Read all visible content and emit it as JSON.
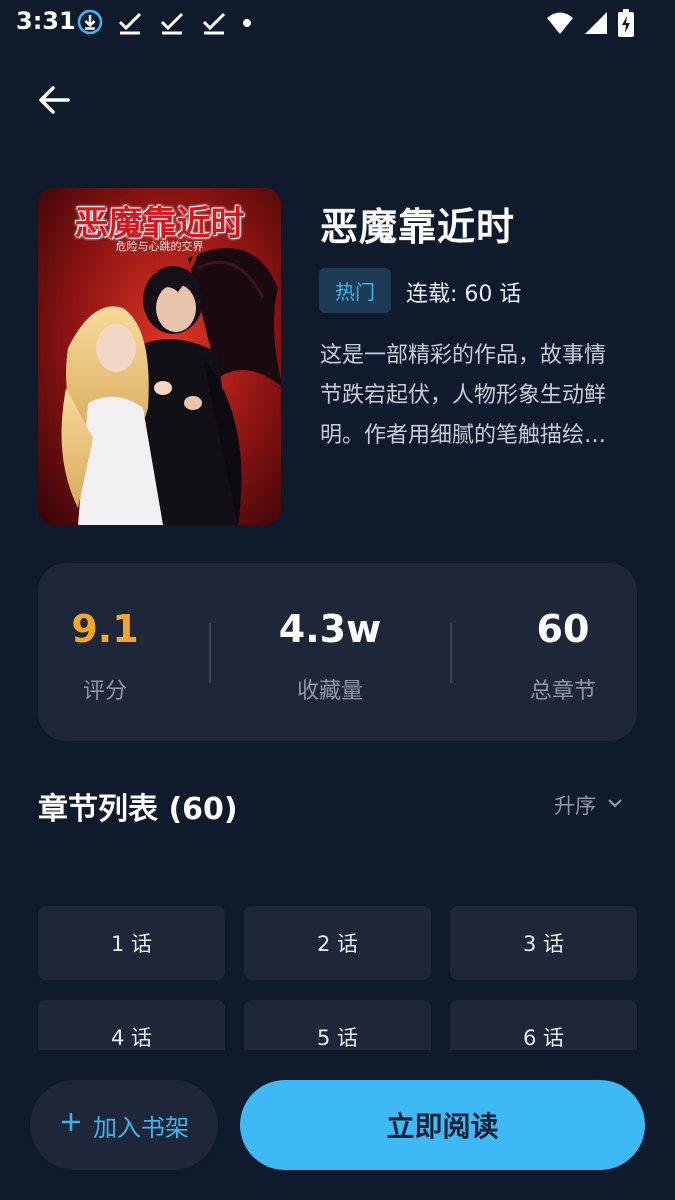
{
  "status_bar": {
    "time": "3:31",
    "icons_left": [
      "download-icon",
      "check-icon",
      "check-icon",
      "check-icon",
      "dot-icon"
    ],
    "icons_right": [
      "wifi-icon",
      "signal-icon",
      "battery-charging-icon"
    ]
  },
  "nav": {
    "back_icon": "arrow-left-icon"
  },
  "book": {
    "cover_title": "恶魔靠近时",
    "cover_subtitle": "危险与心跳的交界",
    "title": "恶魔靠近时",
    "tag": "热门",
    "serial": "连载: 60 话",
    "description": "这是一部精彩的作品，故事情节跌宕起伏，人物形象生动鲜明。作者用细腻的笔触描绘了一个引人入胜的故事。"
  },
  "stats": {
    "rating_value": "9.1",
    "rating_label": "评分",
    "favorites_value": "4.3w",
    "favorites_label": "收藏量",
    "chapters_value": "60",
    "chapters_label": "总章节"
  },
  "chapter_list": {
    "title": "章节列表 (60)",
    "sort_label": "升序",
    "items": [
      "1 话",
      "2 话",
      "3 话",
      "4 话",
      "5 话",
      "6 话"
    ]
  },
  "actions": {
    "add_shelf": "加入书架",
    "read_now": "立即阅读"
  },
  "colors": {
    "background": "#101a2d",
    "card": "#1d2739",
    "accent": "#3dbaf5",
    "rating": "#f5a623"
  }
}
